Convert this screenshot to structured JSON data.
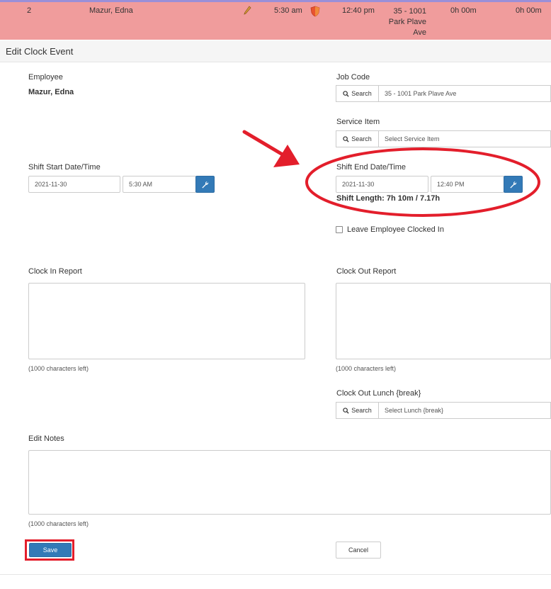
{
  "grid_row": {
    "number": "2",
    "employee": "Mazur, Edna",
    "clock_in": "5:30 am",
    "clock_out": "12:40 pm",
    "job_line1": "35 - 1001",
    "job_line2": "Park Plave",
    "job_line3": "Ave",
    "hours_1": "0h 00m",
    "hours_2": "0h 00m",
    "row_color": "#f09c9c"
  },
  "modal": {
    "title": "Edit Clock Event"
  },
  "employee": {
    "label": "Employee",
    "value": "Mazur, Edna"
  },
  "job_code": {
    "label": "Job Code",
    "search_label": "Search",
    "value": "35 - 1001 Park Plave Ave"
  },
  "service_item": {
    "label": "Service Item",
    "search_label": "Search",
    "placeholder": "Select Service Item"
  },
  "shift_start": {
    "label": "Shift Start Date/Time",
    "date": "2021-11-30",
    "time": "5:30 AM"
  },
  "shift_end": {
    "label": "Shift End Date/Time",
    "date": "2021-11-30",
    "time": "12:40 PM",
    "length": "Shift Length: 7h 10m / 7.17h"
  },
  "leave_clocked_in": {
    "label": "Leave Employee Clocked In",
    "checked": false
  },
  "clock_in_report": {
    "label": "Clock In Report",
    "chars_left": "(1000 characters left)"
  },
  "clock_out_report": {
    "label": "Clock Out Report",
    "chars_left": "(1000 characters left)"
  },
  "clock_out_lunch": {
    "label": "Clock Out Lunch {break}",
    "search_label": "Search",
    "placeholder": "Select Lunch {break}"
  },
  "edit_notes": {
    "label": "Edit Notes",
    "chars_left": "(1000 characters left)"
  },
  "actions": {
    "save_label": "Save",
    "cancel_label": "Cancel"
  },
  "colors": {
    "primary": "#337ab7",
    "annotation": "#e31e2b"
  },
  "icons": [
    "pencil-icon",
    "shield-icon",
    "search-icon",
    "wrench-icon",
    "arrow-annotation",
    "ellipse-annotation"
  ]
}
